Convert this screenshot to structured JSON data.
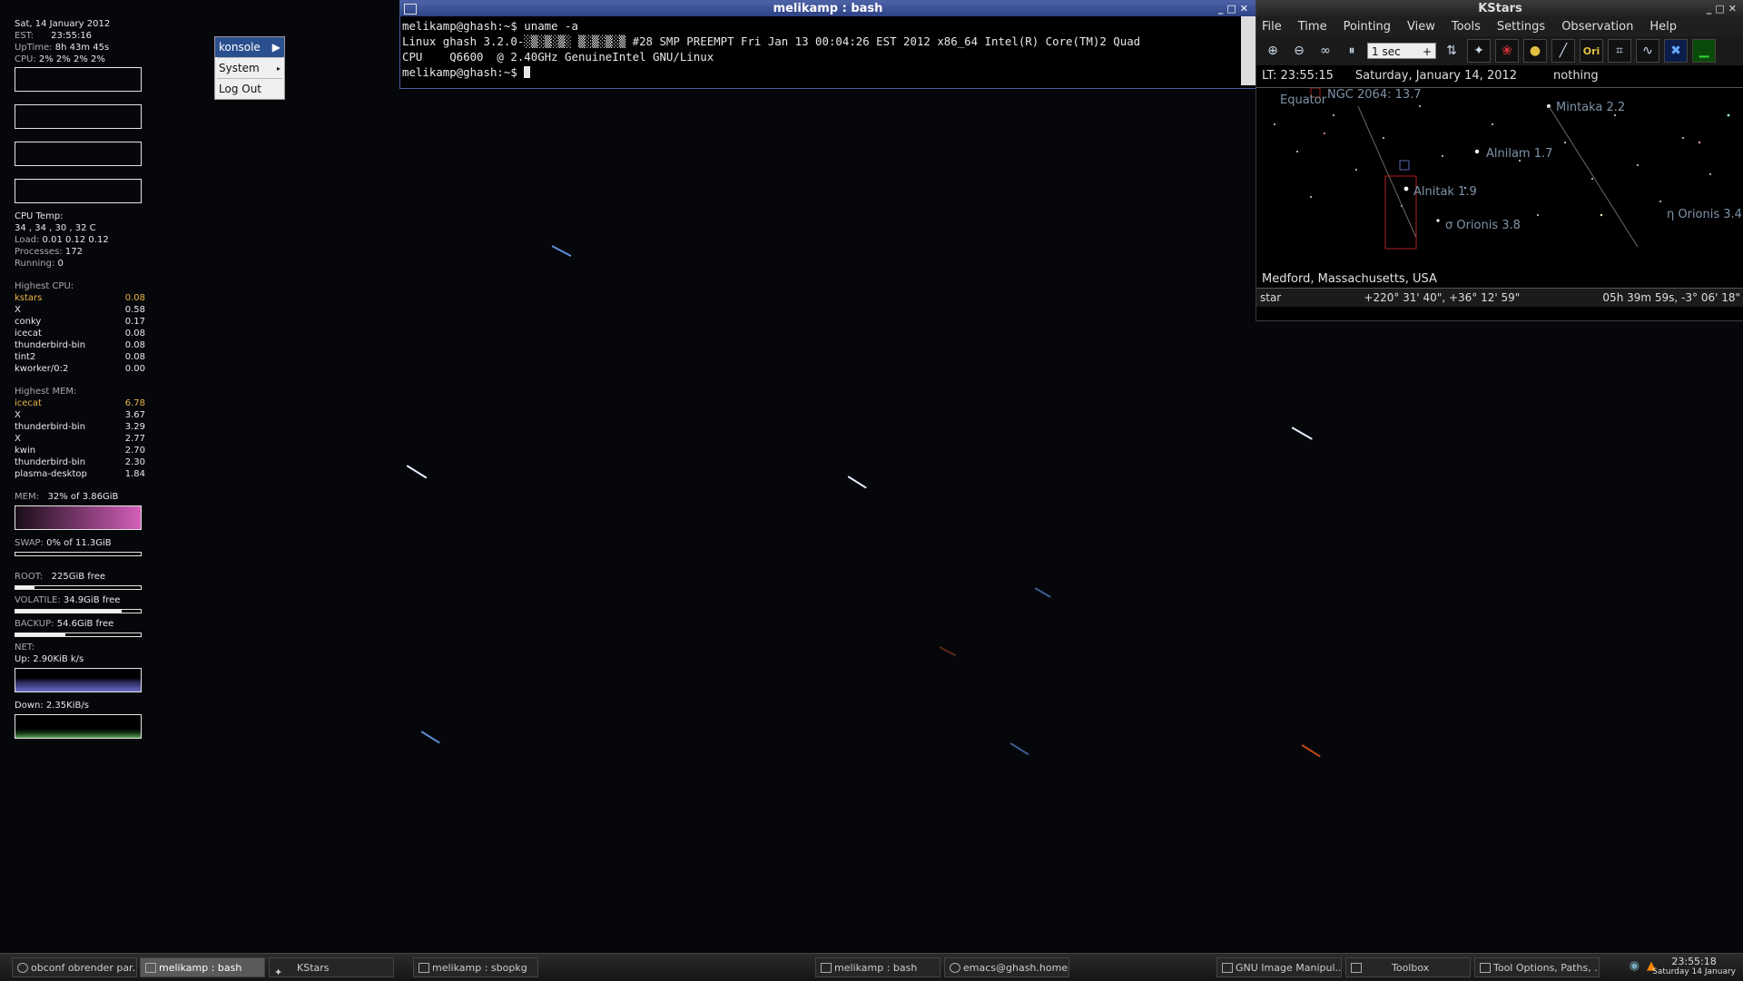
{
  "conky": {
    "date": "Sat, 14 January 2012",
    "tz_label": "EST:",
    "time": "23:55:16",
    "uptime_label": "UpTime:",
    "uptime": "8h 43m 45s",
    "cpu_label": "CPU:",
    "cpu": "2% 2% 2% 2%",
    "cpu_temp_label": "CPU Temp:",
    "cpu_temp": "34 , 34 , 30 , 32  C",
    "load_label": "Load:",
    "load": "0.01 0.12 0.12",
    "processes_label": "Processes:",
    "processes": "172",
    "running_label": "Running:",
    "running": "0",
    "highest_cpu_label": "Highest CPU:",
    "highest_cpu": [
      {
        "name": "kstars",
        "value": "0.08"
      },
      {
        "name": "X",
        "value": "0.58"
      },
      {
        "name": "conky",
        "value": "0.17"
      },
      {
        "name": "icecat",
        "value": "0.08"
      },
      {
        "name": "thunderbird-bin",
        "value": "0.08"
      },
      {
        "name": "tint2",
        "value": "0.08"
      },
      {
        "name": "kworker/0:2",
        "value": "0.00"
      }
    ],
    "highest_mem_label": "Highest MEM:",
    "highest_mem": [
      {
        "name": "icecat",
        "value": "6.78"
      },
      {
        "name": "X",
        "value": "3.67"
      },
      {
        "name": "thunderbird-bin",
        "value": "3.29"
      },
      {
        "name": "X",
        "value": "2.77"
      },
      {
        "name": "kwin",
        "value": "2.70"
      },
      {
        "name": "thunderbird-bin",
        "value": "2.30"
      },
      {
        "name": "plasma-desktop",
        "value": "1.84"
      }
    ],
    "mem_label": "MEM:",
    "mem": "32% of 3.86GiB",
    "swap_label": "SWAP:",
    "swap": "0% of 11.3GiB",
    "root_label": "ROOT:",
    "root": "225GiB  free",
    "root_used_fraction": 0.15,
    "volatile_label": "VOLATILE:",
    "volatile": "34.9GiB free",
    "volatile_used_fraction": 0.85,
    "backup_label": "BACKUP:",
    "backup": "54.6GiB free",
    "backup_used_fraction": 0.4,
    "net_label": "NET:",
    "up": "Up: 2.90KiB k/s",
    "down": "Down: 2.35KiB/s"
  },
  "menu": {
    "items": [
      "konsole",
      "System",
      "Log Out"
    ]
  },
  "terminal": {
    "title": "melikamp : bash",
    "lines": [
      "melikamp@ghash:~$ uname -a",
      "Linux ghash 3.2.0-░▒░▒░▒░ ▒░▒░▒░▒ #28 SMP PREEMPT Fri Jan 13 00:04:26 EST 2012 x86_64 Intel(R) Core(TM)2 Quad",
      "CPU    Q6600  @ 2.40GHz GenuineIntel GNU/Linux",
      "melikamp@ghash:~$ "
    ]
  },
  "kstars": {
    "title": "KStars",
    "menu": [
      "File",
      "Time",
      "Pointing",
      "View",
      "Tools",
      "Settings",
      "Observation",
      "Help"
    ],
    "timestep": "1 sec",
    "lt": "LT: 23:55:15",
    "date": "Saturday, January 14, 2012",
    "focus": "nothing",
    "labels": [
      "NGC 2064: 13.7",
      "Equator",
      "Mintaka 2.2",
      "Alnilam 1.7",
      "Alnitak 1.9",
      "σ Orionis 3.8",
      "η Orionis 3.4"
    ],
    "location": "Medford, Massachusetts, USA",
    "status_object": "star",
    "status_altaz": "+220° 31' 40\", +36° 12' 59\"",
    "status_radec": "05h 39m 59s, -3° 06' 18\""
  },
  "taskbar": {
    "tasks": [
      {
        "label": "obconf obrender par...",
        "active": false
      },
      {
        "label": "melikamp : bash",
        "active": true
      },
      {
        "label": "KStars",
        "active": false
      },
      {
        "label": "melikamp : sbopkg",
        "active": false
      },
      {
        "label": "melikamp : bash",
        "active": false
      },
      {
        "label": "emacs@ghash.home",
        "active": false
      },
      {
        "label": "GNU Image Manipul...",
        "active": false
      },
      {
        "label": "Toolbox",
        "active": false
      },
      {
        "label": "Tool Options, Paths, ...",
        "active": false
      }
    ],
    "clock_time": "23:55:18",
    "clock_date": "Saturday 14 January"
  }
}
